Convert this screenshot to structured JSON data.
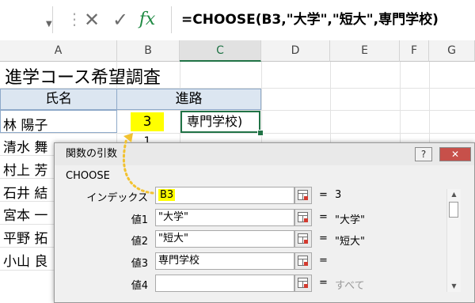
{
  "formula_bar": {
    "name_box": "",
    "cancel_icon": "✕",
    "enter_icon": "✓",
    "fx_label": "fx",
    "formula": "=CHOOSE(B3,\"大学\",\"短大\",専門学校)"
  },
  "columns": [
    "A",
    "B",
    "C",
    "D",
    "E",
    "F",
    "G"
  ],
  "sheet": {
    "title": "進学コース希望調査",
    "header_name": "氏名",
    "header_course": "進路",
    "names": [
      "林 陽子",
      "清水 舞",
      "村上 芳",
      "石井 結",
      "宮本 一",
      "平野 拓",
      "小山 良"
    ],
    "b3": "3",
    "b4": "1",
    "c3": "専門学校)"
  },
  "dialog": {
    "title": "関数の引数",
    "help_label": "?",
    "close_label": "✕",
    "function_name": "CHOOSE",
    "args": [
      {
        "label": "インデックス",
        "value": "B3",
        "result": "3"
      },
      {
        "label": "値1",
        "value": "\"大学\"",
        "result": "\"大学\""
      },
      {
        "label": "値2",
        "value": "\"短大\"",
        "result": "\"短大\""
      },
      {
        "label": "値3",
        "value": "専門学校",
        "result": ""
      },
      {
        "label": "値4",
        "value": "",
        "result": "すべて"
      }
    ],
    "equals": "="
  },
  "colors": {
    "accent": "#217346",
    "highlight": "#ffff00",
    "header_fill": "#dce6f1",
    "arrow": "#f2c230"
  }
}
